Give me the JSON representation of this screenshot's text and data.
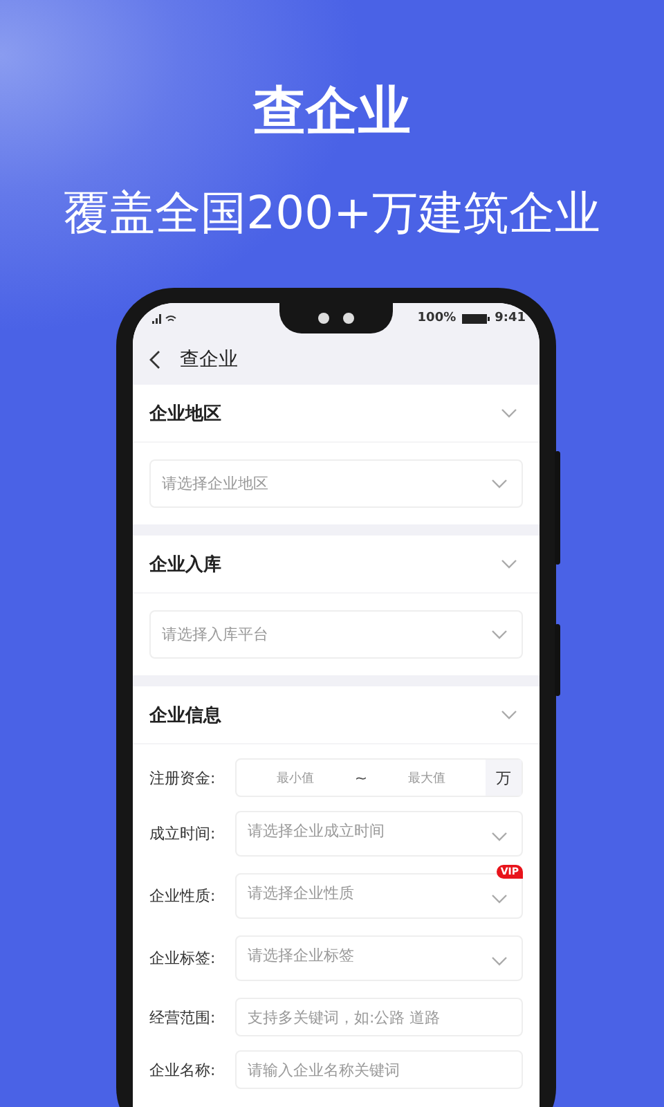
{
  "headline": "查企业",
  "subheadline": "覆盖全国200+万建筑企业",
  "status_bar": {
    "battery_text": "100%",
    "time": "9:41"
  },
  "nav": {
    "title": "查企业"
  },
  "sections": [
    {
      "title": "企业地区",
      "expanded": true,
      "placeholder": "请选择企业地区"
    },
    {
      "title": "企业入库",
      "expanded": true,
      "placeholder": "请选择入库平台"
    }
  ],
  "info": {
    "title": "企业信息",
    "expanded": true,
    "fields": [
      {
        "kind": "range",
        "label": "注册资金:",
        "min_placeholder": "最小值",
        "separator": "~",
        "max_placeholder": "最大值",
        "unit": "万"
      },
      {
        "kind": "select",
        "label": "成立时间:",
        "placeholder": "请选择企业成立时间"
      },
      {
        "kind": "select",
        "label": "企业性质:",
        "placeholder": "请选择企业性质",
        "badge": "VIP"
      },
      {
        "kind": "select",
        "label": "企业标签:",
        "placeholder": "请选择企业标签"
      },
      {
        "kind": "text",
        "label": "经营范围:",
        "placeholder": "支持多关键词，如:公路 道路"
      },
      {
        "kind": "text",
        "label": "企业名称:",
        "placeholder": "请输入企业名称关键词"
      }
    ]
  }
}
